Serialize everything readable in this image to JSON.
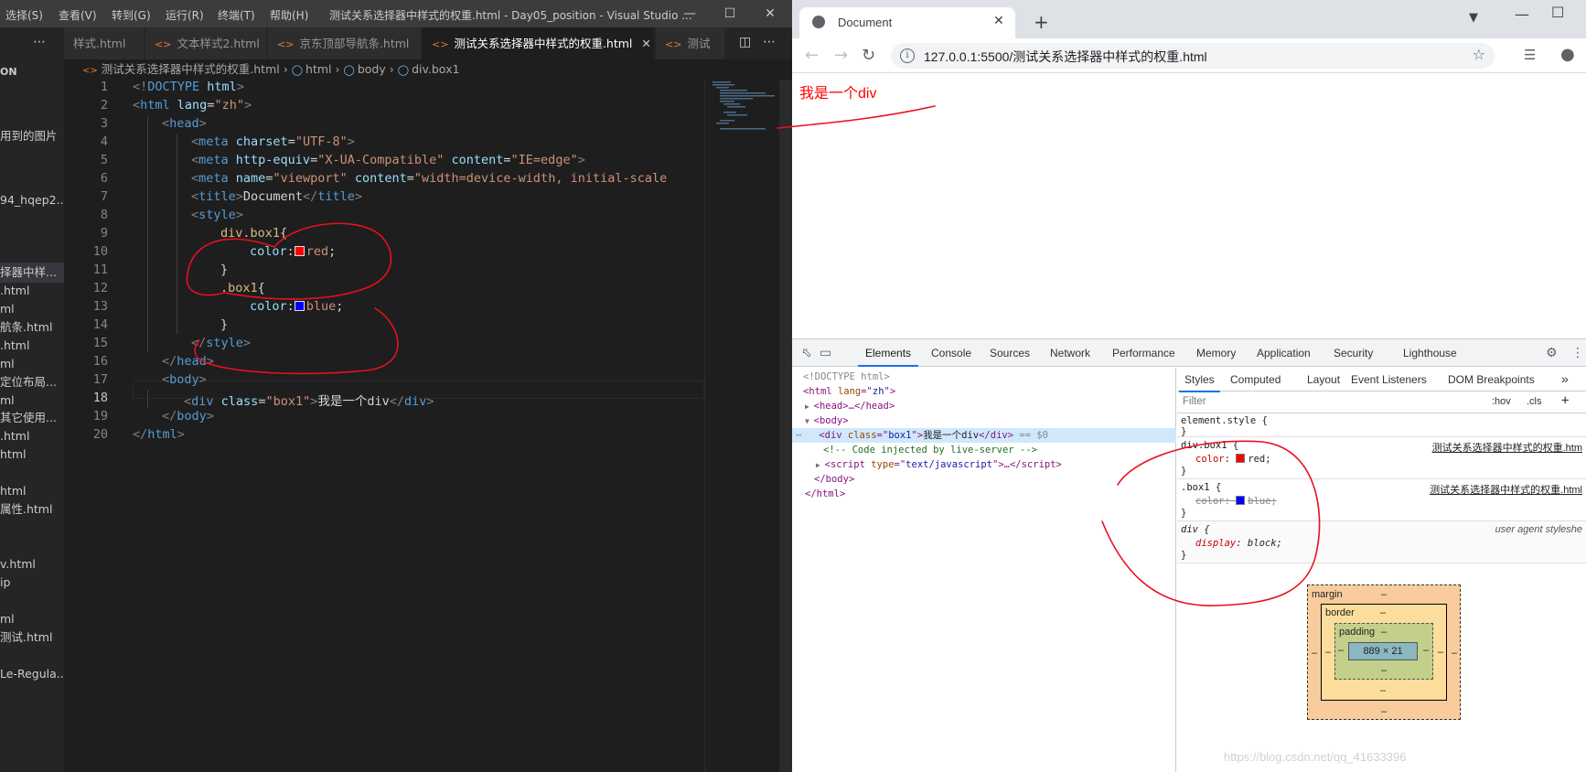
{
  "vscode": {
    "menu": [
      "选择(S)",
      "查看(V)",
      "转到(G)",
      "运行(R)",
      "终端(T)",
      "帮助(H)"
    ],
    "window_title": "测试关系选择器中样式的权重.html - Day05_position - Visual Studio ...",
    "sidebar": {
      "header": "ON",
      "items": [
        "用到的图片",
        "94_hqep2...",
        "择器中样...",
        ".html",
        "ml",
        "航条.html",
        ".html",
        "ml",
        "定位布局...",
        "ml",
        "其它使用...",
        ".html",
        "html",
        "html",
        "属性.html",
        "v.html",
        "ip",
        "ml",
        "测试.html",
        "Le-Regula..."
      ]
    },
    "tabs": [
      {
        "label": "样式.html",
        "active": false
      },
      {
        "label": "文本样式2.html",
        "active": false
      },
      {
        "label": "京东顶部导航条.html",
        "active": false
      },
      {
        "label": "测试关系选择器中样式的权重.html",
        "active": true
      },
      {
        "label": "测试",
        "active": false
      }
    ],
    "breadcrumb": [
      "测试关系选择器中样式的权重.html",
      "html",
      "body",
      "div.box1"
    ],
    "line_numbers": [
      "1",
      "2",
      "3",
      "4",
      "5",
      "6",
      "7",
      "8",
      "9",
      "10",
      "11",
      "12",
      "13",
      "14",
      "15",
      "16",
      "17",
      "18",
      "19",
      "20"
    ],
    "current_line": "18",
    "code": {
      "l1": [
        "<!",
        "DOCTYPE",
        " html",
        ">"
      ],
      "l2": [
        "<",
        "html",
        " lang",
        "=",
        "\"zh\"",
        ">"
      ],
      "l3": [
        "<",
        "head",
        ">"
      ],
      "l4": [
        "<",
        "meta",
        " charset",
        "=",
        "\"UTF-8\"",
        ">"
      ],
      "l5": [
        "<",
        "meta",
        " http-equiv",
        "=",
        "\"X-UA-Compatible\"",
        " content",
        "=",
        "\"IE=edge\"",
        ">"
      ],
      "l6": [
        "<",
        "meta",
        " name",
        "=",
        "\"viewport\"",
        " content",
        "=",
        "\"width=device-width, initial-scale"
      ],
      "l7": [
        "<",
        "title",
        ">",
        "Document",
        "</",
        "title",
        ">"
      ],
      "l8": [
        "<",
        "style",
        ">"
      ],
      "l9": [
        "div.box1",
        "{"
      ],
      "l10": [
        "color",
        ":",
        "red",
        ";"
      ],
      "l11": [
        "}"
      ],
      "l12": [
        ".box1",
        "{"
      ],
      "l13": [
        "color",
        ":",
        "blue",
        ";"
      ],
      "l14": [
        "}"
      ],
      "l15": [
        "</",
        "style",
        ">"
      ],
      "l16": [
        "</",
        "head",
        ">"
      ],
      "l17": [
        "<",
        "body",
        ">"
      ],
      "l18": [
        "<",
        "div",
        " class",
        "=",
        "\"box1\"",
        ">",
        "我是一个div",
        "</",
        "div",
        ">"
      ],
      "l19": [
        "</",
        "body",
        ">"
      ],
      "l20": [
        "</",
        "html",
        ">"
      ]
    }
  },
  "chrome": {
    "tab_title": "Document",
    "url": "127.0.0.1:5500/测试关系选择器中样式的权重.html",
    "page_text": "我是一个div",
    "page_text_color": "#ff0000"
  },
  "devtools": {
    "tabs": [
      "Elements",
      "Console",
      "Sources",
      "Network",
      "Performance",
      "Memory",
      "Application",
      "Security",
      "Lighthouse"
    ],
    "elements": {
      "l1": "<!DOCTYPE html>",
      "l2a": "<",
      "l2b": "html",
      "l2c": " lang",
      "l2d": "=\"",
      "l2e": "zh",
      "l2f": "\">",
      "l3a": "<",
      "l3b": "head",
      "l3c": ">…</",
      "l3d": "head",
      "l3e": ">",
      "l4a": "<",
      "l4b": "body",
      "l4c": ">",
      "l5a": "<",
      "l5b": "div",
      "l5c": " class",
      "l5d": "=\"",
      "l5e": "box1",
      "l5f": "\">",
      "l5g": "我是一个div",
      "l5h": "</",
      "l5i": "div",
      "l5j": ">",
      "l5k": " == $0",
      "l6": "<!-- Code injected by live-server -->",
      "l7a": "<",
      "l7b": "script",
      "l7c": " type",
      "l7d": "=\"",
      "l7e": "text/javascript",
      "l7f": "\">…</",
      "l7g": "script",
      "l7h": ">",
      "l8a": "</",
      "l8b": "body",
      "l8c": ">",
      "l9a": "</",
      "l9b": "html",
      "l9c": ">"
    },
    "styles": {
      "tabs": [
        "Styles",
        "Computed",
        "Layout",
        "Event Listeners",
        "DOM Breakpoints"
      ],
      "filter_placeholder": "Filter",
      "hov": ":hov",
      "cls": ".cls",
      "plus": "+",
      "rules": [
        {
          "selector": "element.style {",
          "close": "}"
        },
        {
          "selector": "div.box1 {",
          "prop": "color",
          "value": "red;",
          "source": "测试关系选择器中样式的权重.htm",
          "close": "}"
        },
        {
          "selector": ".box1 {",
          "prop": "color",
          "value": "blue;",
          "source": "测试关系选择器中样式的权重.html",
          "close": "}"
        },
        {
          "selector": "div {",
          "prop": "display",
          "value": "block;",
          "source": "user agent styleshe",
          "close": "}"
        }
      ],
      "box_model": {
        "margin": "margin",
        "border": "border",
        "padding": "padding",
        "dash": "–",
        "content_size": "889 × 21"
      }
    }
  },
  "watermark": "https://blog.csdn.net/qq_41633396",
  "colors": {
    "red_swatch": "#ff0000",
    "blue_swatch": "#0000ff",
    "annotation_ink": "#e8101e"
  }
}
